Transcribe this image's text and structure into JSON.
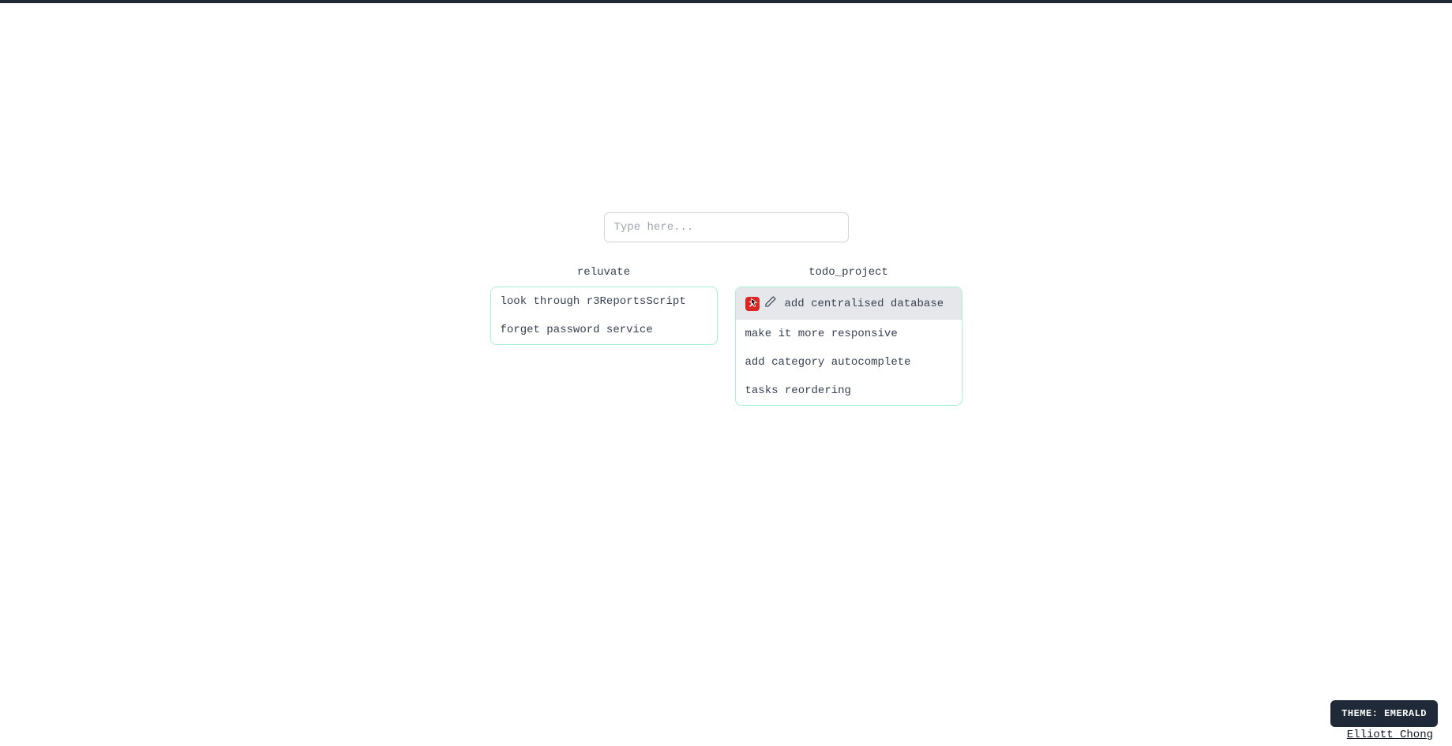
{
  "search": {
    "placeholder": "Type here...",
    "value": ""
  },
  "columns": [
    {
      "title": "reluvate",
      "tasks": [
        {
          "text": "look through r3ReportsScript",
          "hovered": false
        },
        {
          "text": "forget password service",
          "hovered": false
        }
      ]
    },
    {
      "title": "todo_project",
      "tasks": [
        {
          "text": "add centralised database",
          "hovered": true
        },
        {
          "text": "make it more responsive",
          "hovered": false
        },
        {
          "text": "add category autocomplete",
          "hovered": false
        },
        {
          "text": "tasks reordering",
          "hovered": false
        }
      ]
    }
  ],
  "theme_label": "THEME: EMERALD",
  "footer_name": "Elliott Chong"
}
